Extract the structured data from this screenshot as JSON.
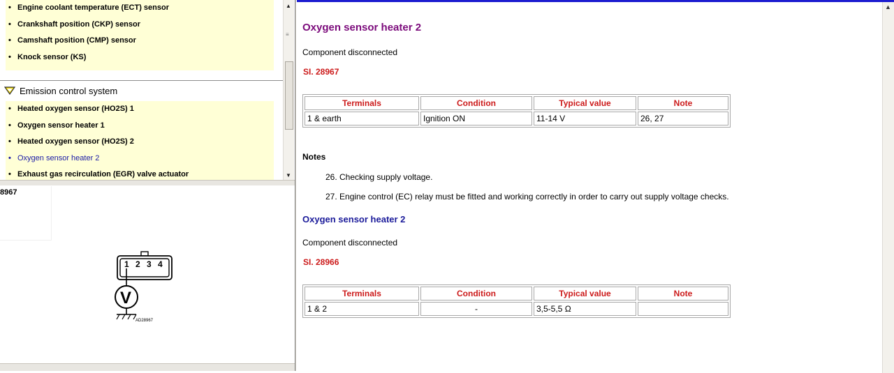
{
  "nav": {
    "group1_items": [
      {
        "label": "Engine coolant temperature (ECT) sensor"
      },
      {
        "label": "Crankshaft position (CKP) sensor"
      },
      {
        "label": "Camshaft position (CMP) sensor"
      },
      {
        "label": "Knock sensor (KS)"
      }
    ],
    "group2_title": "Emission control system",
    "group2_items": [
      {
        "label": "Heated oxygen sensor (HO2S) 1"
      },
      {
        "label": "Oxygen sensor heater 1"
      },
      {
        "label": "Heated oxygen sensor (HO2S) 2"
      },
      {
        "label": "Oxygen sensor heater 2"
      },
      {
        "label": "Exhaust gas recirculation (EGR) valve actuator"
      }
    ]
  },
  "diagram": {
    "ref_label": "8967",
    "pins": [
      "1",
      "2",
      "3",
      "4"
    ],
    "meter_symbol": "V",
    "code": "AD28967"
  },
  "content": {
    "title": "Oxygen sensor heater 2",
    "section1": {
      "status": "Component disconnected",
      "si": "SI. 28967",
      "headers": [
        "Terminals",
        "Condition",
        "Typical value",
        "Note"
      ],
      "row": [
        "1 & earth",
        "Ignition ON",
        "11-14 V",
        "26, 27"
      ]
    },
    "notes_heading": "Notes",
    "notes": [
      "26. Checking supply voltage.",
      "27. Engine control (EC) relay must be fitted and working correctly in order to carry out supply voltage checks."
    ],
    "subtitle": "Oxygen sensor heater 2",
    "section2": {
      "status": "Component disconnected",
      "si": "SI. 28966",
      "headers": [
        "Terminals",
        "Condition",
        "Typical value",
        "Note"
      ],
      "row": [
        "1 & 2",
        "-",
        "3,5-5,5 Ω",
        ""
      ]
    }
  }
}
